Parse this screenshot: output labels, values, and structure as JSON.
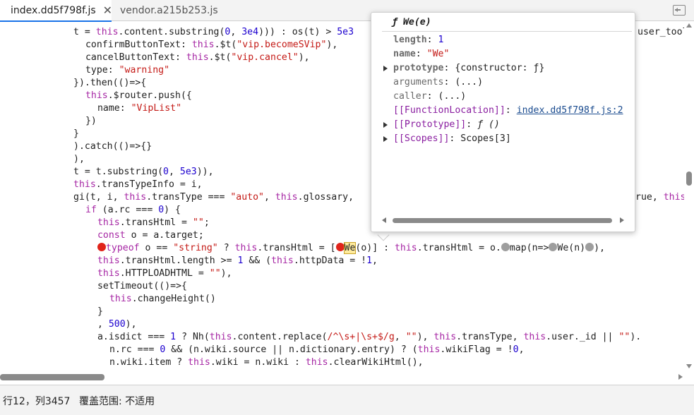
{
  "tabs": [
    {
      "label": "index.dd5f798f.js",
      "close": "✕"
    },
    {
      "label": "vendor.a215b253.js"
    }
  ],
  "code_lines": [
    {
      "html": "t = <span class=\"th\">this</span>.content.substring(<span class=\"num\">0</span>, <span class=\"num\">3e4</span>))) : os(t) > <span class=\"num\">5e3</span>"
    },
    {
      "html": "    confirmButtonText: <span class=\"th\">this</span>.$t(<span class=\"str\">\"vip.becomeSVip\"</span>),"
    },
    {
      "html": "    cancelButtonText: <span class=\"th\">this</span>.$t(<span class=\"str\">\"vip.cancel\"</span>),"
    },
    {
      "html": "    type: <span class=\"str\">\"warning\"</span>"
    },
    {
      "html": "}).then(()=>{"
    },
    {
      "html": "    <span class=\"th\">this</span>.$router.push({"
    },
    {
      "html": "        name: <span class=\"str\">\"VipList\"</span>"
    },
    {
      "html": "    })"
    },
    {
      "html": "}"
    },
    {
      "html": ").catch(()=>{}"
    },
    {
      "html": "),"
    },
    {
      "html": "t = t.substring(<span class=\"num\">0</span>, <span class=\"num\">5e3</span>)),"
    },
    {
      "html": "<span class=\"th\">this</span>.transTypeInfo = i,"
    },
    {
      "html": "gi(t, i, <span class=\"th\">this</span>.transType === <span class=\"str\">\"auto\"</span>, <span class=\"th\">this</span>.glossary,"
    },
    {
      "html": "    <span class=\"kw\">if</span> (a.rc === <span class=\"num\">0</span>) {"
    },
    {
      "html": "        <span class=\"th\">this</span>.transHtml = <span class=\"str\">\"\"</span>;"
    },
    {
      "html": "        <span class=\"kw\">const</span> o = a.target;"
    },
    {
      "html": "        <span class=\"bp-red\"></span><span class=\"kw\">typeof</span> o == <span class=\"str\">\"string\"</span> ? <span class=\"th\">this</span>.transHtml = [<span class=\"bp-red\"></span><span class=\"hl\">We</span>(o)] : <span class=\"th\">this</span>.transHtml = o.<span class=\"bp-grey\"></span>map(n=><span class=\"bp-grey\"></span>We(n)<span class=\"bp-grey\"></span>),"
    },
    {
      "html": "        <span class=\"th\">this</span>.transHtml.length >= <span class=\"num\">1</span> && (<span class=\"th\">this</span>.httpData = !<span class=\"num\">1</span>,"
    },
    {
      "html": "        <span class=\"th\">this</span>.HTTPLOADHTML = <span class=\"str\">\"\"</span>),"
    },
    {
      "html": "        setTimeout(()=>{"
    },
    {
      "html": "            <span class=\"th\">this</span>.changeHeight()"
    },
    {
      "html": "        }"
    },
    {
      "html": "        , <span class=\"num\">500</span>),"
    },
    {
      "html": "        a.isdict === <span class=\"num\">1</span> ? Nh(<span class=\"th\">this</span>.content.replace(<span class=\"str\">/^\\s+|\\s+$/g</span>, <span class=\"str\">\"\"</span>), <span class=\"th\">this</span>.transType, <span class=\"th\">this</span>.user._id || <span class=\"str\">\"\"</span>)."
    },
    {
      "html": "            n.rc === <span class=\"num\">0</span> && (n.wiki.source || n.dictionary.entry) ? (<span class=\"th\">this</span>.wikiFlag = !<span class=\"num\">0</span>,"
    },
    {
      "html": "            n.wiki.item ? <span class=\"th\">this</span>.wiki = n.wiki : <span class=\"th\">this</span>.clearWikiHtml(),"
    }
  ],
  "right_edge_fragments": [
    {
      "text": "user_tool"
    },
    {
      "html": "rue, <span class=\"th\">this</span>"
    }
  ],
  "popover": {
    "f_glyph": "ƒ",
    "title": "We(e)",
    "props": [
      {
        "expand": false,
        "key": "length",
        "sep": ": ",
        "value": "1",
        "vclass": "n",
        "kclass": ""
      },
      {
        "expand": false,
        "key": "name",
        "sep": ": ",
        "value": "\"We\"",
        "vclass": "s",
        "kclass": ""
      },
      {
        "expand": true,
        "key": "prototype",
        "sep": ": ",
        "value": "{constructor: ƒ}",
        "vclass": "",
        "kclass": ""
      },
      {
        "expand": false,
        "key": "arguments",
        "sep": ": ",
        "value": "(...)",
        "vclass": "",
        "kclass": "dim"
      },
      {
        "expand": false,
        "key": "caller",
        "sep": ": ",
        "value": "(...)",
        "vclass": "",
        "kclass": "dim"
      },
      {
        "expand": false,
        "key": "[[FunctionLocation]]",
        "sep": ": ",
        "value": "index.dd5f798f.js:2",
        "vclass": "link",
        "kclass": "int"
      },
      {
        "expand": true,
        "key": "[[Prototype]]",
        "sep": ": ",
        "value": "ƒ ()",
        "vclass": "i int-v",
        "kclass": "int"
      },
      {
        "expand": true,
        "key": "[[Scopes]]",
        "sep": ": ",
        "value": "Scopes[3]",
        "vclass": "",
        "kclass": "int"
      }
    ]
  },
  "status": {
    "position": "行12，列3457",
    "coverage": "覆盖范围: 不适用"
  }
}
